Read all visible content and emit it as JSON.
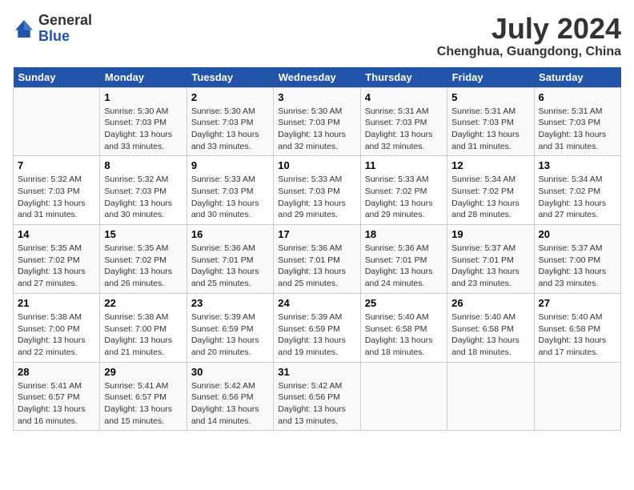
{
  "header": {
    "logo_general": "General",
    "logo_blue": "Blue",
    "month_year": "July 2024",
    "location": "Chenghua, Guangdong, China"
  },
  "weekdays": [
    "Sunday",
    "Monday",
    "Tuesday",
    "Wednesday",
    "Thursday",
    "Friday",
    "Saturday"
  ],
  "weeks": [
    [
      {
        "day": "",
        "info": ""
      },
      {
        "day": "1",
        "info": "Sunrise: 5:30 AM\nSunset: 7:03 PM\nDaylight: 13 hours\nand 33 minutes."
      },
      {
        "day": "2",
        "info": "Sunrise: 5:30 AM\nSunset: 7:03 PM\nDaylight: 13 hours\nand 33 minutes."
      },
      {
        "day": "3",
        "info": "Sunrise: 5:30 AM\nSunset: 7:03 PM\nDaylight: 13 hours\nand 32 minutes."
      },
      {
        "day": "4",
        "info": "Sunrise: 5:31 AM\nSunset: 7:03 PM\nDaylight: 13 hours\nand 32 minutes."
      },
      {
        "day": "5",
        "info": "Sunrise: 5:31 AM\nSunset: 7:03 PM\nDaylight: 13 hours\nand 31 minutes."
      },
      {
        "day": "6",
        "info": "Sunrise: 5:31 AM\nSunset: 7:03 PM\nDaylight: 13 hours\nand 31 minutes."
      }
    ],
    [
      {
        "day": "7",
        "info": "Sunrise: 5:32 AM\nSunset: 7:03 PM\nDaylight: 13 hours\nand 31 minutes."
      },
      {
        "day": "8",
        "info": "Sunrise: 5:32 AM\nSunset: 7:03 PM\nDaylight: 13 hours\nand 30 minutes."
      },
      {
        "day": "9",
        "info": "Sunrise: 5:33 AM\nSunset: 7:03 PM\nDaylight: 13 hours\nand 30 minutes."
      },
      {
        "day": "10",
        "info": "Sunrise: 5:33 AM\nSunset: 7:03 PM\nDaylight: 13 hours\nand 29 minutes."
      },
      {
        "day": "11",
        "info": "Sunrise: 5:33 AM\nSunset: 7:02 PM\nDaylight: 13 hours\nand 29 minutes."
      },
      {
        "day": "12",
        "info": "Sunrise: 5:34 AM\nSunset: 7:02 PM\nDaylight: 13 hours\nand 28 minutes."
      },
      {
        "day": "13",
        "info": "Sunrise: 5:34 AM\nSunset: 7:02 PM\nDaylight: 13 hours\nand 27 minutes."
      }
    ],
    [
      {
        "day": "14",
        "info": "Sunrise: 5:35 AM\nSunset: 7:02 PM\nDaylight: 13 hours\nand 27 minutes."
      },
      {
        "day": "15",
        "info": "Sunrise: 5:35 AM\nSunset: 7:02 PM\nDaylight: 13 hours\nand 26 minutes."
      },
      {
        "day": "16",
        "info": "Sunrise: 5:36 AM\nSunset: 7:01 PM\nDaylight: 13 hours\nand 25 minutes."
      },
      {
        "day": "17",
        "info": "Sunrise: 5:36 AM\nSunset: 7:01 PM\nDaylight: 13 hours\nand 25 minutes."
      },
      {
        "day": "18",
        "info": "Sunrise: 5:36 AM\nSunset: 7:01 PM\nDaylight: 13 hours\nand 24 minutes."
      },
      {
        "day": "19",
        "info": "Sunrise: 5:37 AM\nSunset: 7:01 PM\nDaylight: 13 hours\nand 23 minutes."
      },
      {
        "day": "20",
        "info": "Sunrise: 5:37 AM\nSunset: 7:00 PM\nDaylight: 13 hours\nand 23 minutes."
      }
    ],
    [
      {
        "day": "21",
        "info": "Sunrise: 5:38 AM\nSunset: 7:00 PM\nDaylight: 13 hours\nand 22 minutes."
      },
      {
        "day": "22",
        "info": "Sunrise: 5:38 AM\nSunset: 7:00 PM\nDaylight: 13 hours\nand 21 minutes."
      },
      {
        "day": "23",
        "info": "Sunrise: 5:39 AM\nSunset: 6:59 PM\nDaylight: 13 hours\nand 20 minutes."
      },
      {
        "day": "24",
        "info": "Sunrise: 5:39 AM\nSunset: 6:59 PM\nDaylight: 13 hours\nand 19 minutes."
      },
      {
        "day": "25",
        "info": "Sunrise: 5:40 AM\nSunset: 6:58 PM\nDaylight: 13 hours\nand 18 minutes."
      },
      {
        "day": "26",
        "info": "Sunrise: 5:40 AM\nSunset: 6:58 PM\nDaylight: 13 hours\nand 18 minutes."
      },
      {
        "day": "27",
        "info": "Sunrise: 5:40 AM\nSunset: 6:58 PM\nDaylight: 13 hours\nand 17 minutes."
      }
    ],
    [
      {
        "day": "28",
        "info": "Sunrise: 5:41 AM\nSunset: 6:57 PM\nDaylight: 13 hours\nand 16 minutes."
      },
      {
        "day": "29",
        "info": "Sunrise: 5:41 AM\nSunset: 6:57 PM\nDaylight: 13 hours\nand 15 minutes."
      },
      {
        "day": "30",
        "info": "Sunrise: 5:42 AM\nSunset: 6:56 PM\nDaylight: 13 hours\nand 14 minutes."
      },
      {
        "day": "31",
        "info": "Sunrise: 5:42 AM\nSunset: 6:56 PM\nDaylight: 13 hours\nand 13 minutes."
      },
      {
        "day": "",
        "info": ""
      },
      {
        "day": "",
        "info": ""
      },
      {
        "day": "",
        "info": ""
      }
    ]
  ]
}
